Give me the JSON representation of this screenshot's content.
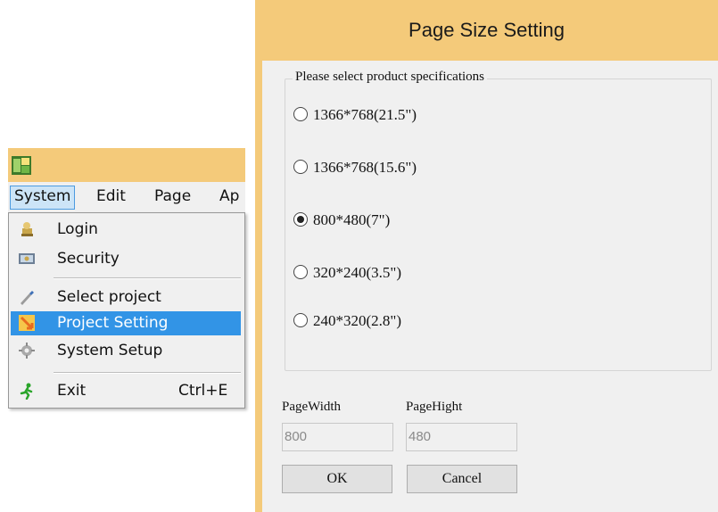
{
  "menubar": {
    "items": [
      "System",
      "Edit",
      "Page",
      "Ap"
    ]
  },
  "system_menu": {
    "items": [
      {
        "label": "Login",
        "icon": "login-icon"
      },
      {
        "label": "Security",
        "icon": "security-icon"
      },
      {
        "label": "Select project",
        "icon": "select-project-icon"
      },
      {
        "label": "Project Setting",
        "icon": "project-setting-icon"
      },
      {
        "label": "System Setup",
        "icon": "system-setup-icon"
      },
      {
        "label": "Exit",
        "icon": "exit-icon",
        "shortcut": "Ctrl+E"
      }
    ],
    "selected": "Project Setting"
  },
  "dialog": {
    "title": "Page Size Setting",
    "group_label": "Please select product specifications",
    "options": [
      "1366*768(21.5\")",
      "1366*768(15.6\")",
      "800*480(7\")",
      "320*240(3.5\")",
      "240*320(2.8\")"
    ],
    "selected_option": "800*480(7\")",
    "page_width_label": "PageWidth",
    "page_height_label": "PageHight",
    "page_width_value": "800",
    "page_height_value": "480",
    "ok_label": "OK",
    "cancel_label": "Cancel"
  },
  "colors": {
    "title_bar": "#f4ca7a",
    "menu_highlight": "#3294e6",
    "menubar_active": "#cce4f7"
  }
}
